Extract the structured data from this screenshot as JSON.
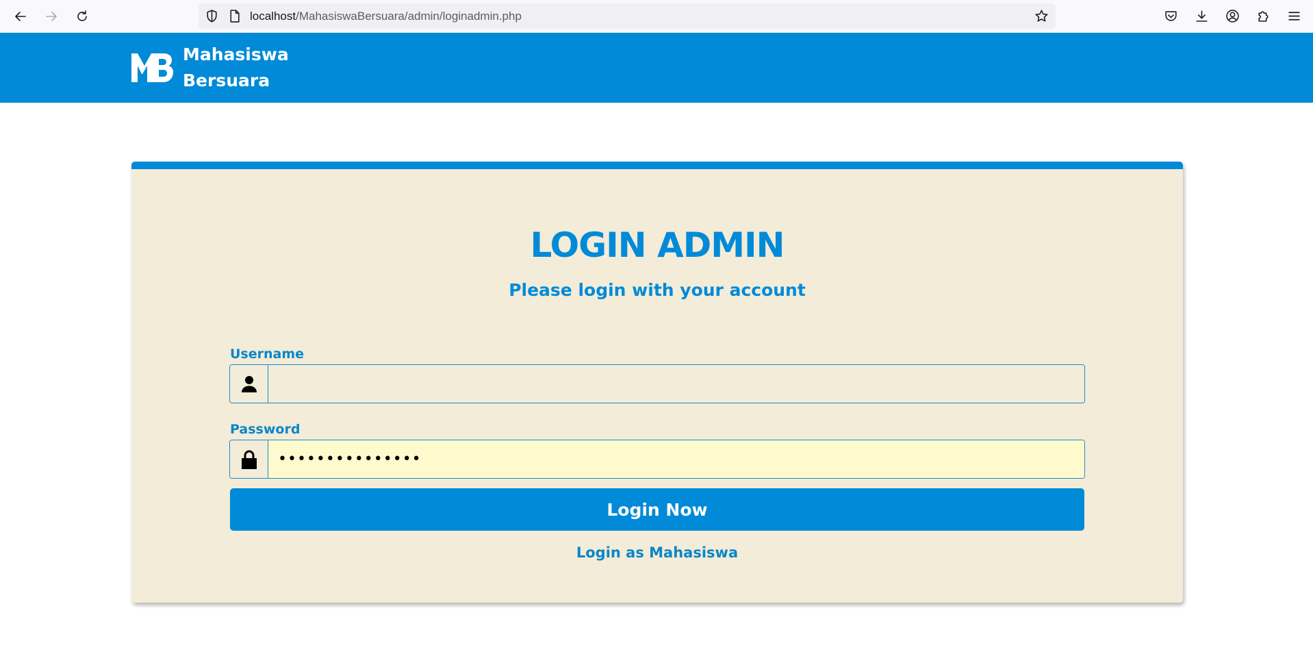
{
  "browser": {
    "url_host": "localhost",
    "url_path": "/MahasiswaBersuara/admin/loginadmin.php",
    "icons": {
      "back": "arrow-left-icon",
      "forward": "arrow-right-icon",
      "reload": "reload-icon",
      "tracking": "shield-icon",
      "page_info": "page-icon",
      "bookmark": "star-icon",
      "pocket": "pocket-icon",
      "downloads": "download-icon",
      "account": "account-icon",
      "extensions": "puzzle-icon",
      "menu": "hamburger-menu-icon"
    }
  },
  "header": {
    "logo_mark": "MB",
    "brand_line1": "Mahasiswa",
    "brand_line2": "Bersuara",
    "background_color": "#008ad8"
  },
  "login": {
    "title": "LOGIN ADMIN",
    "subtitle": "Please login with your account",
    "username_label": "Username",
    "username_value": "",
    "username_icon": "user-icon",
    "password_label": "Password",
    "password_masked": "•••••••••••••••",
    "password_icon": "lock-icon",
    "submit_label": "Login Now",
    "alt_link": "Login as Mahasiswa",
    "card_color": "#f2ecd8",
    "accent_color": "#008ad8"
  }
}
